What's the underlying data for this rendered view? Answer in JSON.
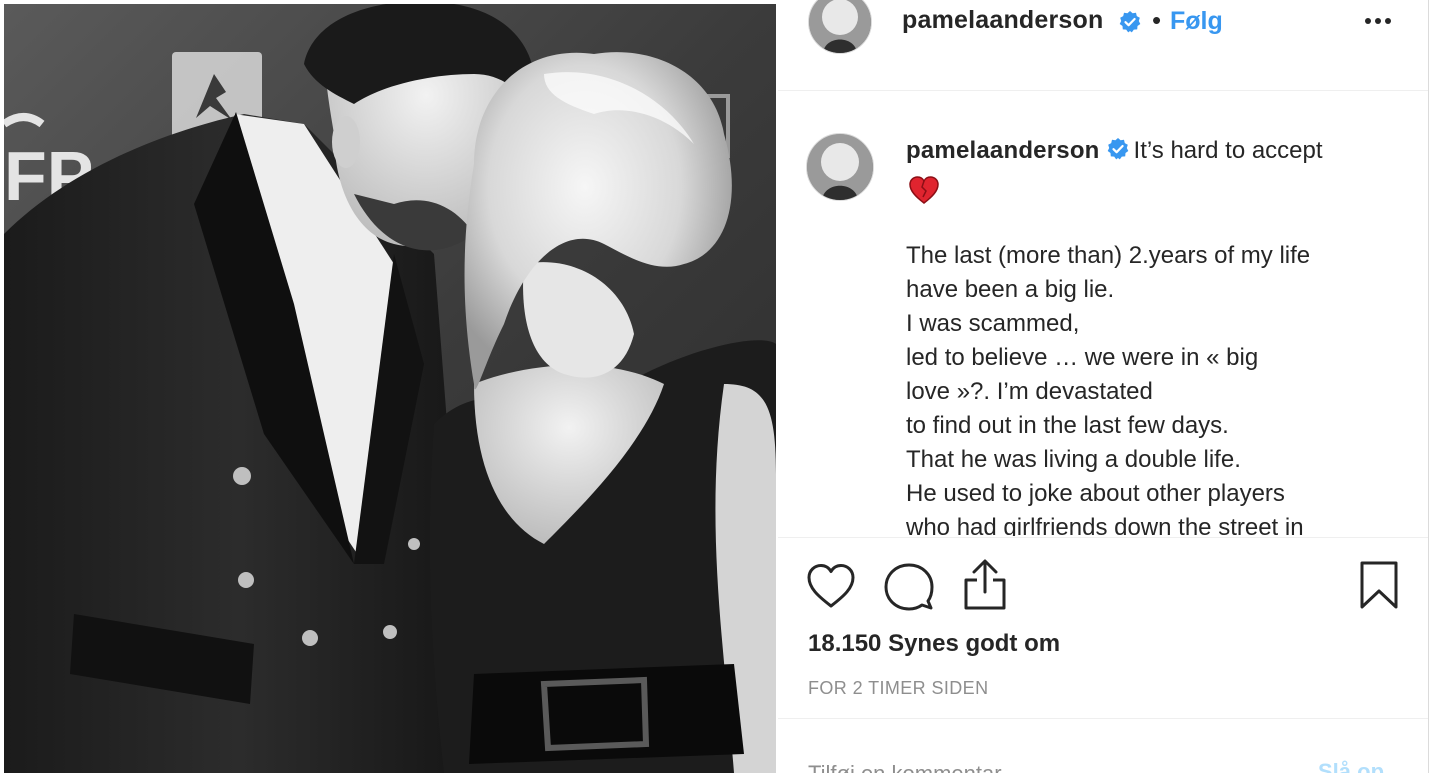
{
  "post": {
    "image_alt": "Black-and-white photo of a man in a double-breasted black suit leaning toward a blonde woman in a black dress at a red-carpet event"
  },
  "header": {
    "username": "pamelaanderson",
    "separator": "•",
    "follow_label": "Følg",
    "more_icon": "more-horizontal-icon",
    "verified_icon": "verified-badge-icon"
  },
  "caption": {
    "username": "pamelaanderson",
    "first_text": "It’s hard to accept",
    "emoji_icon": "red-heart-emoji-icon",
    "lines": [
      "The last (more than) 2.years of my life",
      "have been a big lie.",
      "I was scammed,",
      "led to believe … we were in « big",
      "love »?. I’m devastated",
      "to find out in the last few days.",
      "That he was living a double life.",
      "He used to joke about other players",
      "who had girlfriends down the street in"
    ]
  },
  "actions": {
    "like_icon": "heart-outline-icon",
    "comment_icon": "comment-bubble-icon",
    "share_icon": "share-upload-icon",
    "save_icon": "bookmark-icon",
    "likes_text": "18.150 Synes godt om",
    "timestamp": "FOR 2 TIMER SIDEN"
  },
  "comment_box": {
    "placeholder": "Tilføj en kommentar ...",
    "post_label": "Slå op"
  },
  "colors": {
    "accent_blue": "#3897f0",
    "post_button_disabled": "#b2dffc",
    "text_primary": "#262626",
    "text_secondary": "#8e8e8e",
    "heart_red": "#e0242f",
    "divider": "#efefef"
  }
}
